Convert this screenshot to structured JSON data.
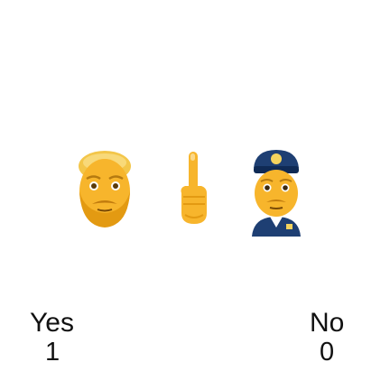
{
  "emojis": [
    {
      "icon": "bearded-man-face-icon"
    },
    {
      "icon": "middle-finger-icon"
    },
    {
      "icon": "police-officer-icon"
    }
  ],
  "answers": {
    "yes": {
      "label": "Yes",
      "value": "1"
    },
    "no": {
      "label": "No",
      "value": "0"
    }
  },
  "colors": {
    "skin": "#F7B52C",
    "skin_dark": "#E39A12",
    "hair": "#F3C64A",
    "uniform": "#1E3F73",
    "badge": "#F4D35E",
    "text": "#111111"
  }
}
